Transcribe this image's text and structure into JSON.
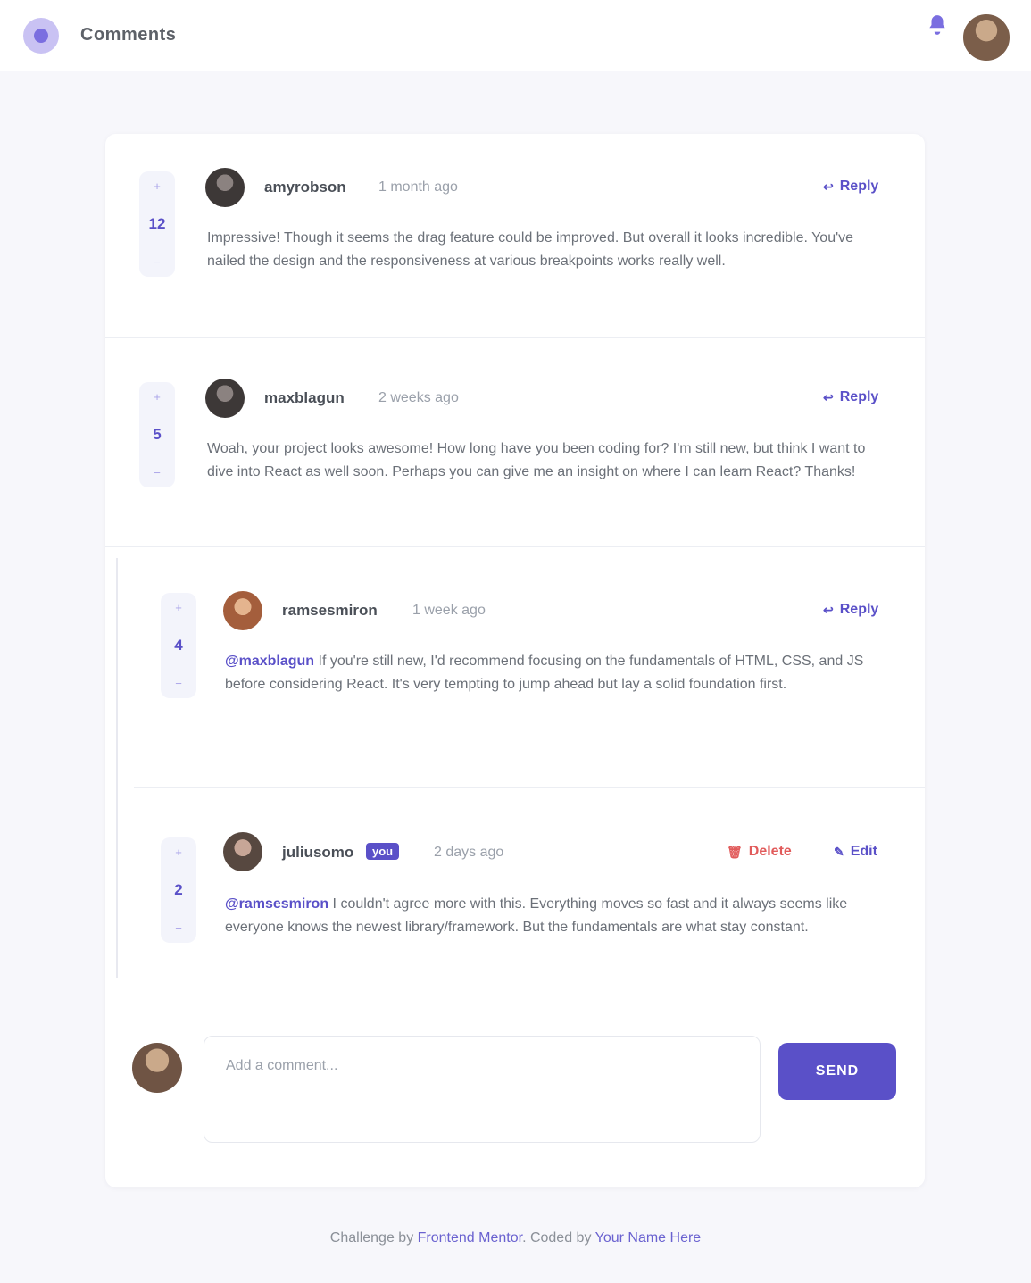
{
  "header": {
    "brand": "Comments",
    "notification_icon": "bell-icon",
    "user_avatar_icon": "user-avatar"
  },
  "comments": [
    {
      "score": "12",
      "username": "amyrobson",
      "timestamp": "1 month ago",
      "reply_label": "Reply",
      "body": "Impressive! Though it seems the drag feature could be improved. But overall it looks incredible. You've nailed the design and the responsiveness at various breakpoints works really well."
    },
    {
      "score": "5",
      "username": "maxblagun",
      "timestamp": "2 weeks ago",
      "reply_label": "Reply",
      "body": "Woah, your project looks awesome! How long have you been coding for? I'm still new, but think I want to dive into React as well soon. Perhaps you can give me an insight on where I can learn React? Thanks!"
    }
  ],
  "replies": [
    {
      "score": "4",
      "username": "ramsesmiron",
      "timestamp": "1 week ago",
      "reply_label": "Reply",
      "mention": "@maxblagun",
      "body": "If you're still new, I'd recommend focusing on the fundamentals of HTML, CSS, and JS before considering React. It's very tempting to jump ahead but lay a solid foundation first."
    },
    {
      "score": "2",
      "username": "juliusomo",
      "you_badge": "you",
      "timestamp": "2 days ago",
      "delete_label": "Delete",
      "edit_label": "Edit",
      "mention": "@ramsesmiron",
      "body": "I couldn't agree more with this. Everything moves so fast and it always seems like everyone knows the newest library/framework. But the fundamentals are what stay constant."
    }
  ],
  "composer": {
    "placeholder": "Add a comment...",
    "send_label": "SEND"
  },
  "footer": {
    "prefix": "Challenge by",
    "link1": "Frontend Mentor",
    "middle": ". Coded by",
    "link2": "Your Name Here"
  },
  "colors": {
    "accent": "#5a50c8",
    "danger": "#e15b5b",
    "background": "#f7f7fb"
  }
}
